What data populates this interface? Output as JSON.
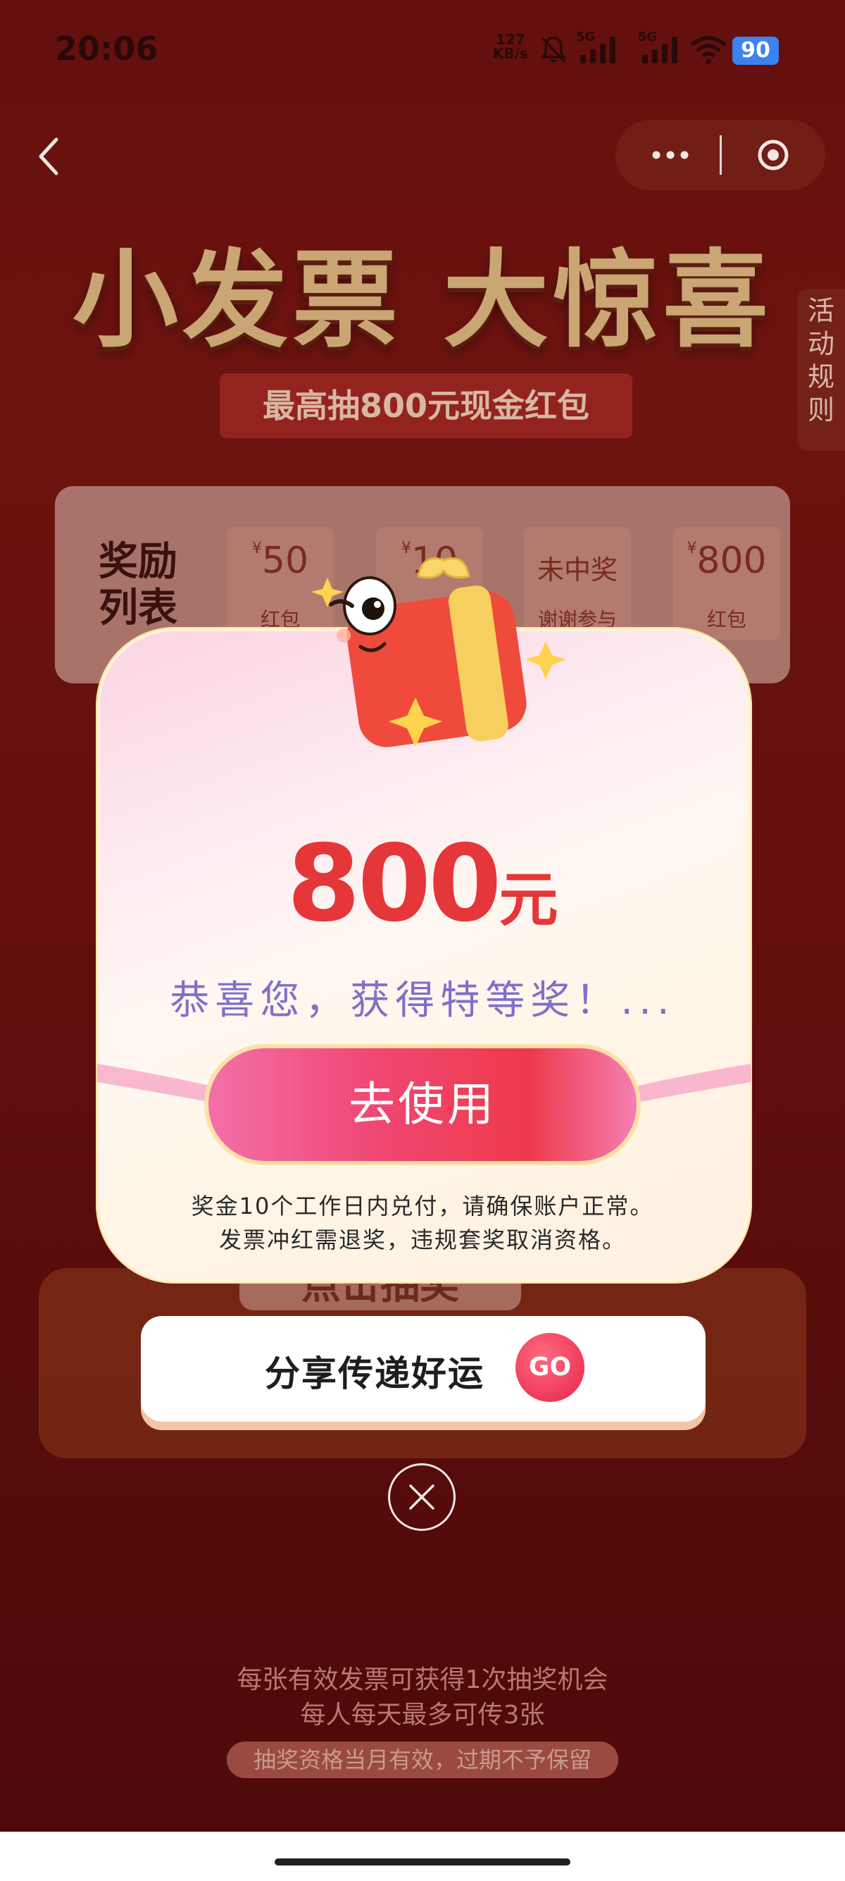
{
  "status_bar": {
    "time": "20:06",
    "net_speed_value": "127",
    "net_speed_unit": "KB/s",
    "signal1": "5G",
    "signal2": "5G",
    "battery": "90",
    "accent": "#3c82f0"
  },
  "nav": {
    "more_icon": "more-dots-icon",
    "close_icon": "close-circle-icon"
  },
  "hero": {
    "title": "小发票 大惊喜",
    "subtitle": "最高抽800元现金红包",
    "rules_tab": [
      "活",
      "动",
      "规",
      "则"
    ]
  },
  "reward_list": {
    "title_line1": "奖励",
    "title_line2": "列表",
    "items": [
      {
        "amount": "50",
        "currency": "¥",
        "label": "红包"
      },
      {
        "amount": "10",
        "currency": "¥",
        "label": ""
      },
      {
        "amount": "未中奖",
        "currency": "",
        "label": "谢谢参与"
      },
      {
        "amount": "800",
        "currency": "¥",
        "label": "红包"
      }
    ]
  },
  "modal": {
    "amount": "800",
    "unit": "元",
    "message": "恭喜您，获得特等奖！...",
    "use_button": "去使用",
    "note_line1": "奖金10个工作日内兑付，请确保账户正常。",
    "note_line2": "发票冲红需退奖，违规套奖取消资格。",
    "amount_color": "#e5363a",
    "message_color": "#8070c8"
  },
  "share": {
    "label": "分享传递好运",
    "go": "GO"
  },
  "background": {
    "draw_button": "点击抽奖",
    "info_line1": "每张有效发票可获得1次抽奖机会",
    "info_line2": "每人每天最多可传3张",
    "pill": "抽奖资格当月有效，过期不予保留"
  }
}
